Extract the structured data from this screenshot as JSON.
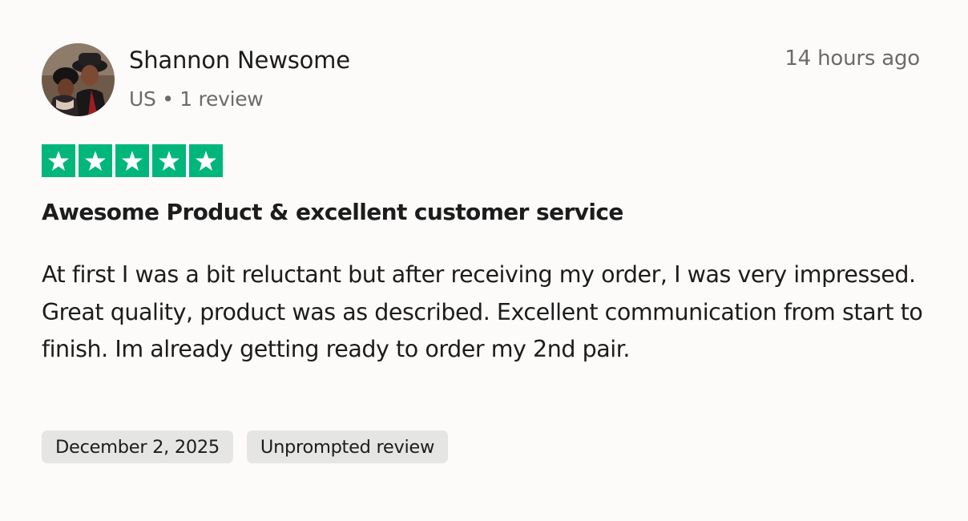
{
  "review": {
    "reviewer": {
      "name": "Shannon Newsome",
      "meta": "US • 1 review",
      "avatar": "avatar-photo"
    },
    "time_ago": "14 hours ago",
    "rating": {
      "value": 5,
      "max": 5,
      "color": "#00b67a",
      "icon": "star-icon"
    },
    "title": "Awesome Product & excellent customer service",
    "body": "At first I was a bit reluctant but after receiving my order, I was very impressed. Great quality, product was as described. Excellent communication from start to finish. Im already getting ready to order my 2nd pair.",
    "tags": [
      {
        "label": "December 2, 2025"
      },
      {
        "label": "Unprompted review"
      }
    ]
  }
}
